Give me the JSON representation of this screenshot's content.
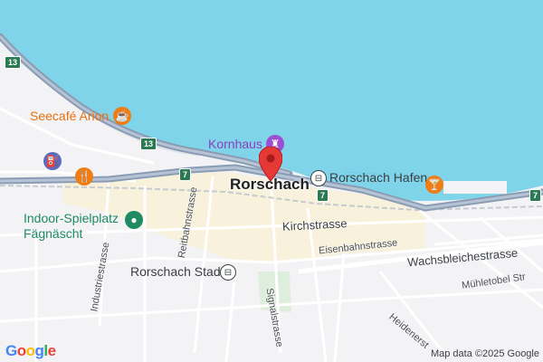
{
  "map": {
    "place": "Rorschach",
    "pois": {
      "seecafe": "Seecafé Arion",
      "kornhaus": "Kornhaus",
      "hafen": "Rorschach Hafen",
      "indoor": "Indoor-Spielplatz\nFägnäscht",
      "stadt": "Rorschach Stadt"
    },
    "streets": {
      "kirchstrasse": "Kirchstrasse",
      "eisenbahnstrasse": "Eisenbahnstrasse",
      "wachsbleichestrasse": "Wachsbleichestrasse",
      "muehletobel": "Mühletobel Str",
      "industriestrasse": "Industriestrasse",
      "reitbahnstrasse": "Reitbahnstrasse",
      "signalstrasse": "Signalstrasse",
      "heidenerstrasse": "Heidenerst"
    },
    "shields": [
      "13",
      "13",
      "7",
      "7",
      "7"
    ],
    "colors": {
      "water": "#7fd4ea",
      "land": "#f3f3f5",
      "highway": "#8a9cb4",
      "town_area": "#fcefc5",
      "pin": "#e53935",
      "poi_orange": "#f07c14",
      "poi_purple": "#9b4fd0",
      "poi_green": "#1f8a63"
    },
    "icons": [
      "coffee-icon",
      "chess-rook-icon",
      "train-icon",
      "cocktail-icon",
      "fuel-icon",
      "restaurant-icon",
      "park-icon",
      "train-station-icon",
      "map-pin-icon"
    ]
  },
  "branding": {
    "logo": "Google",
    "attribution": "Map data ©2025 Google"
  }
}
